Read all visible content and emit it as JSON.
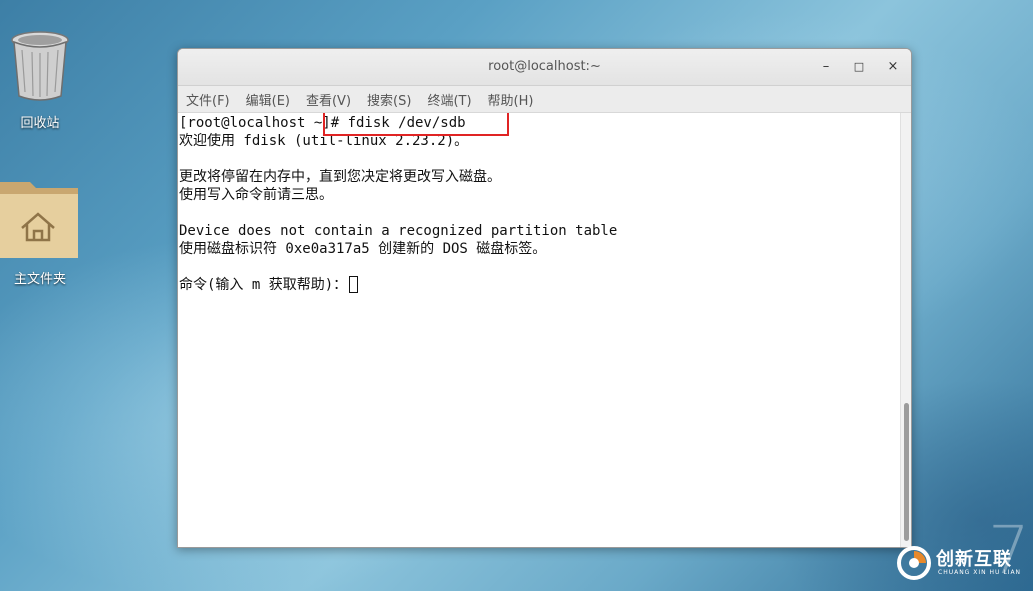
{
  "desktop": {
    "trash_label": "回收站",
    "home_label": "主文件夹"
  },
  "window": {
    "title": "root@localhost:~",
    "minimize_symbol": "–",
    "maximize_symbol": "□",
    "close_symbol": "×"
  },
  "menubar": {
    "items": [
      {
        "label": "文件(F)"
      },
      {
        "label": "编辑(E)"
      },
      {
        "label": "查看(V)"
      },
      {
        "label": "搜索(S)"
      },
      {
        "label": "终端(T)"
      },
      {
        "label": "帮助(H)"
      }
    ]
  },
  "terminal": {
    "lines": [
      "[root@localhost ~]# fdisk /dev/sdb",
      "欢迎使用 fdisk (util-linux 2.23.2)。",
      "",
      "更改将停留在内存中，直到您决定将更改写入磁盘。",
      "使用写入命令前请三思。",
      "",
      "Device does not contain a recognized partition table",
      "使用磁盘标识符 0xe0a317a5 创建新的 DOS 磁盘标签。",
      "",
      "命令(输入 m 获取帮助)："
    ]
  },
  "watermark": {
    "brand": "创新互联",
    "sub": "CHUANG XIN HU LIAN",
    "corner_numeral": "7"
  },
  "icons": {
    "trash": "trash-icon",
    "home": "home-folder-icon",
    "watermark_logo": "brand-logo-icon"
  },
  "colors": {
    "highlight": "#e02424",
    "terminal_bg": "#ffffff",
    "terminal_fg": "#111111"
  }
}
